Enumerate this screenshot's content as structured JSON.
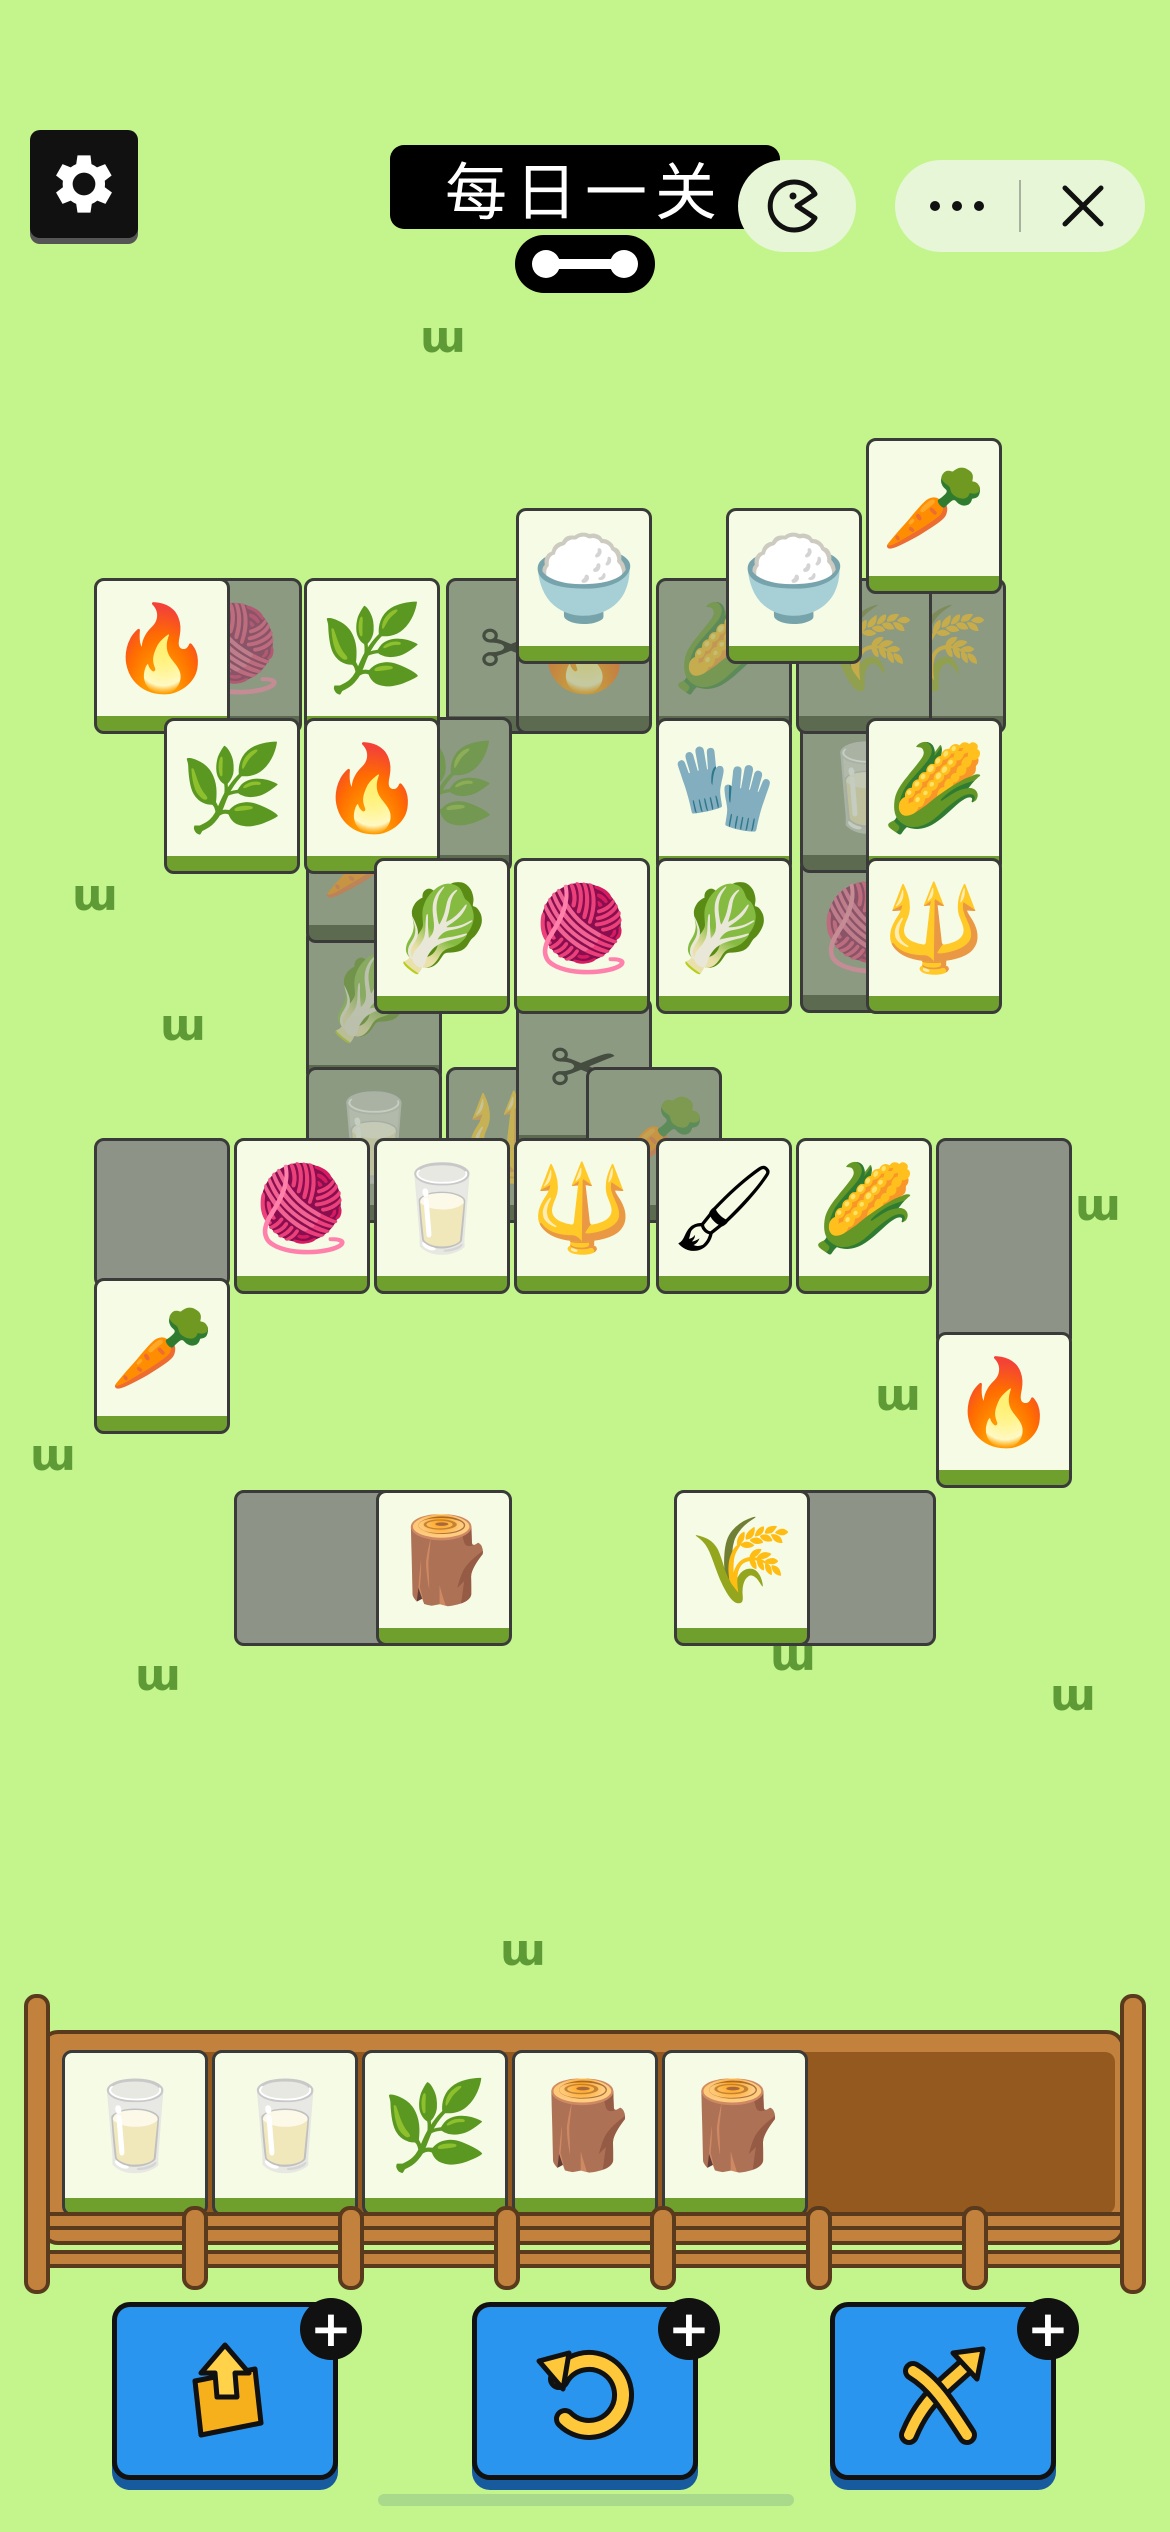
{
  "header": {
    "title": "每日一关",
    "settings_icon": "gear-icon",
    "pill_icon": "dumbbell-pill-icon",
    "mini_program_icon": "pacman-icon",
    "more_icon": "more-dots-icon",
    "close_icon": "close-icon"
  },
  "board": {
    "tiles": [
      {
        "item": "wheat",
        "glyph": "🌾",
        "dim": true
      },
      {
        "item": "cabbage",
        "glyph": "🥬",
        "dim": true
      },
      {
        "item": "carrot",
        "glyph": "🥕",
        "dim": true
      },
      {
        "item": "bottle",
        "glyph": "🥛",
        "dim": true
      },
      {
        "item": "pitchfork",
        "glyph": "🔱",
        "dim": true
      },
      {
        "item": "shears",
        "glyph": "✂",
        "dim": true
      },
      {
        "item": "yarn",
        "glyph": "🧶",
        "dim": true
      },
      {
        "item": "bottle",
        "glyph": "🥛",
        "dim": true
      },
      {
        "item": "carrot",
        "glyph": "🥕",
        "dim": true
      },
      {
        "item": "shears",
        "glyph": "✂",
        "dim": true
      },
      {
        "item": "campfire",
        "glyph": "🔥",
        "dim": true
      },
      {
        "item": "yarn",
        "glyph": "🧶",
        "dim": true
      },
      {
        "item": "grass",
        "glyph": "🌿",
        "dim": true
      },
      {
        "item": "corn",
        "glyph": "🌽",
        "dim": true
      },
      {
        "item": "wheat",
        "glyph": "🌾",
        "dim": true
      },
      {
        "item": "carrot",
        "glyph": "🥕",
        "dim": false
      },
      {
        "item": "rice",
        "glyph": "🍚",
        "dim": false
      },
      {
        "item": "rice",
        "glyph": "🍚",
        "dim": false
      },
      {
        "item": "campfire",
        "glyph": "🔥",
        "dim": false
      },
      {
        "item": "grass",
        "glyph": "🌿",
        "dim": false
      },
      {
        "item": "grass",
        "glyph": "🌿",
        "dim": false
      },
      {
        "item": "campfire",
        "glyph": "🔥",
        "dim": false
      },
      {
        "item": "glove",
        "glyph": "🧤",
        "dim": false
      },
      {
        "item": "corn",
        "glyph": "🌽",
        "dim": false
      },
      {
        "item": "cabbage",
        "glyph": "🥬",
        "dim": false
      },
      {
        "item": "yarn",
        "glyph": "🧶",
        "dim": false
      },
      {
        "item": "cabbage",
        "glyph": "🥬",
        "dim": false
      },
      {
        "item": "pitchfork",
        "glyph": "🔱",
        "dim": false
      },
      {
        "item": "yarn",
        "glyph": "🧶",
        "dim": false
      },
      {
        "item": "bottle",
        "glyph": "🥛",
        "dim": false
      },
      {
        "item": "pitchfork",
        "glyph": "🔱",
        "dim": false
      },
      {
        "item": "brush",
        "glyph": "🖌",
        "dim": false
      },
      {
        "item": "corn",
        "glyph": "🌽",
        "dim": false
      },
      {
        "item": "carrot",
        "glyph": "🥕",
        "dim": false
      },
      {
        "item": "campfire",
        "glyph": "🔥",
        "dim": false
      },
      {
        "item": "stump",
        "glyph": "🪵",
        "dim": false
      },
      {
        "item": "wheat",
        "glyph": "🌾",
        "dim": false
      }
    ]
  },
  "tray": {
    "capacity": 7,
    "slots": [
      {
        "item": "bottle",
        "glyph": "🥛"
      },
      {
        "item": "bottle",
        "glyph": "🥛"
      },
      {
        "item": "grass",
        "glyph": "🌿"
      },
      {
        "item": "stump",
        "glyph": "🪵"
      },
      {
        "item": "stump",
        "glyph": "🪵"
      }
    ]
  },
  "tools": [
    {
      "name": "remove",
      "icon": "move-out-icon",
      "plus": "+"
    },
    {
      "name": "undo",
      "icon": "undo-icon",
      "plus": "+"
    },
    {
      "name": "shuffle",
      "icon": "shuffle-icon",
      "plus": "+"
    }
  ],
  "colors": {
    "background": "#c3f58c",
    "tile_face": "#f5fbe5",
    "tile_base": "#6f9f2c",
    "tool_button": "#2a95ee",
    "fence": "#c2813c"
  }
}
